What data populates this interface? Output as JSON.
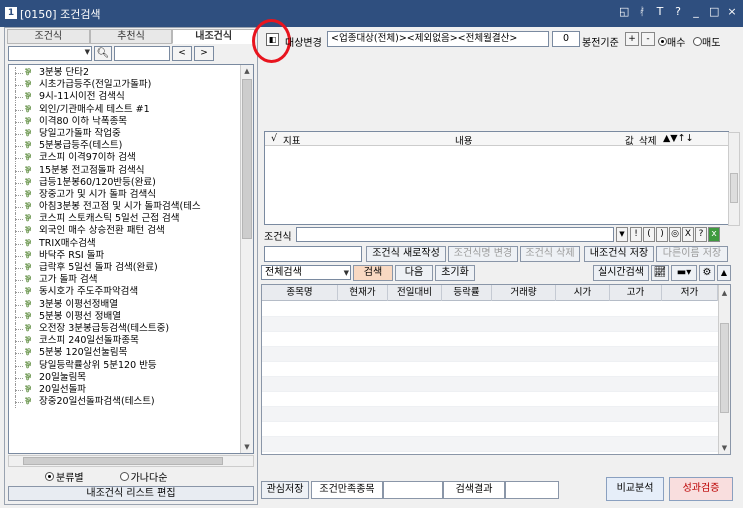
{
  "window": {
    "title": "[0150] 조건검색",
    "icon_number": "1",
    "controls": [
      "◱",
      "T",
      "?",
      "_",
      "□",
      "×"
    ]
  },
  "left": {
    "tabs": [
      {
        "label": "조건식",
        "active": false
      },
      {
        "label": "추천식",
        "active": false
      },
      {
        "label": "내조건식",
        "active": true
      }
    ],
    "nav_prev": "<",
    "nav_next": ">",
    "items": [
      "3분봉 단타2",
      "시초가급등주(전일고가돌파)",
      "9시-11시이전 검색식",
      "외인/기관매수세 테스트 #1",
      "이격80 이하 낙폭종목",
      "당일고가돌파 작업중",
      "5분봉급등주(테스트)",
      "코스피 이격97이하 검색",
      "15분봉 전고점돌파 검색식",
      "급등1분봉60/120반등(완료)",
      "장중고가 및 시가 돌파 검색식",
      "아침3분봉 전고점 및 시가 돌파검색(테스",
      "코스피 스토캐스틱 5일선 근접 검색",
      "외국인 매수 상승전환 패턴 검색",
      "TRIX매수검색",
      "바닥주 RSI 돌파",
      "급락후 5일선 돌파 검색(완료)",
      "고가 돌파 검색",
      "동시호가 주도주파악검색",
      "3분봉 이평선정배열",
      "5분봉 이평선 정배열",
      "오전장 3분봉급등검색(테스트중)",
      "코스피 240일선돌파종목",
      "5분봉 120일선눌림목",
      "당일등락률상위 5분120 반등",
      "20일눌림목",
      "20일선돌파",
      "장중20일선돌파검색(테스트)"
    ],
    "radio_classify": "분류별",
    "radio_alpha": "가나다순",
    "edit_button": "내조건식 리스트 편집"
  },
  "right": {
    "target_label": "대상변경",
    "target_text": "<업종대상(전체)><제외없음><전체월결산>",
    "bong_value": "0",
    "bong_label": "봉전기준",
    "plus": "+",
    "minus": "-",
    "buy_label": "매수",
    "sell_label": "매도",
    "cond_header": {
      "check": "√",
      "indicator": "지표",
      "content": "내용",
      "value": "값",
      "delete": "삭제",
      "arrows": "▲▼↑↓"
    },
    "expr_label": "조건식",
    "expr_buttons": [
      "!",
      "(",
      ")",
      "◎",
      "X",
      "?"
    ],
    "actions": {
      "new": "조건식 새로작성",
      "rename": "조건식명 변경",
      "delete": "조건식 삭제",
      "save": "내조건식 저장",
      "save_as": "다른이름 저장"
    },
    "result": {
      "scope": "전체검색",
      "search": "검색",
      "next": "다음",
      "reset": "초기화",
      "realtime": "실시간검색"
    },
    "grid_headers": [
      "종목명",
      "현재가",
      "전일대비",
      "등락률",
      "거래량",
      "시가",
      "고가",
      "저가"
    ],
    "bottom": {
      "watch_save": "관심저장",
      "satisfied": "조건만족종목",
      "search_result": "검색결과",
      "compare": "비교분석",
      "verify": "성과검증"
    }
  }
}
